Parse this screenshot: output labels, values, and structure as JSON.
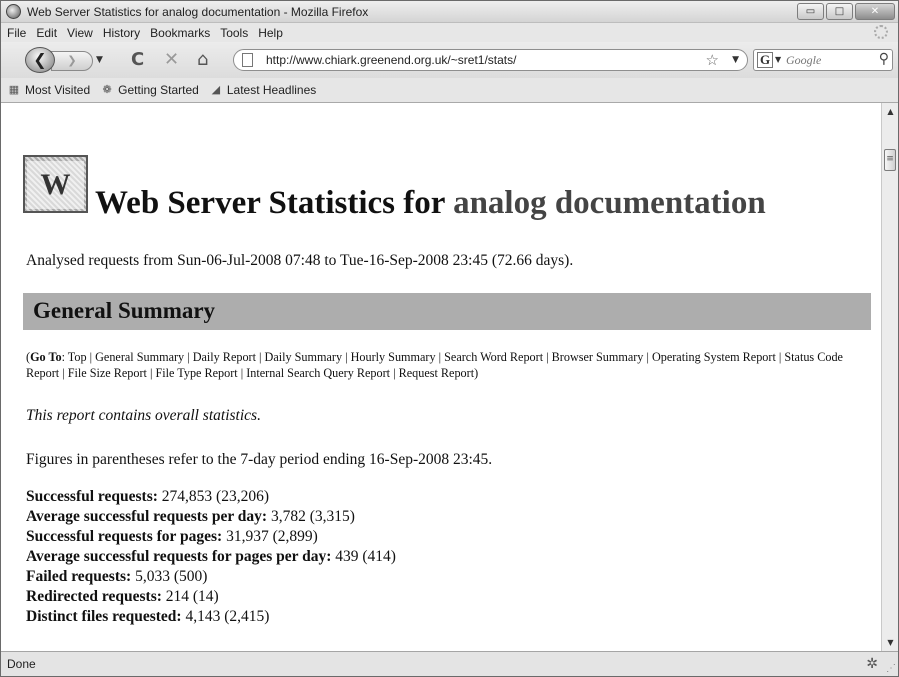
{
  "window": {
    "title": "Web Server Statistics for analog documentation - Mozilla Firefox",
    "controls": {
      "minimize": "▭",
      "maximize": "□",
      "close": "✕"
    }
  },
  "menu": [
    "File",
    "Edit",
    "View",
    "History",
    "Bookmarks",
    "Tools",
    "Help"
  ],
  "toolbar": {
    "back_glyph": "❮",
    "forward_glyph": "❯",
    "dropdown_glyph": "▼",
    "reload_glyph": "C",
    "stop_glyph": "✕",
    "home_glyph": "⌂",
    "url": "http://www.chiark.greenend.org.uk/~sret1/stats/",
    "bookmark_star_glyph": "☆",
    "search_engine_glyph": "G",
    "search_placeholder": "Google",
    "search_glyph": "⚲"
  },
  "bookmarks": [
    {
      "label": "Most Visited",
      "icon": "most-visited-icon",
      "glyph": "▦"
    },
    {
      "label": "Getting Started",
      "icon": "firefox-icon",
      "glyph": "❁"
    },
    {
      "label": "Latest Headlines",
      "icon": "rss-feed-icon",
      "glyph": "◢"
    }
  ],
  "page": {
    "logo_letter": "W",
    "heading_prefix": "Web Server Statistics for",
    "heading_subject": "analog documentation",
    "analysed": "Analysed requests from Sun-06-Jul-2008 07:48 to Tue-16-Sep-2008 23:45 (72.66 days).",
    "section_title": "General Summary",
    "goto": {
      "open": "(",
      "label": "Go To",
      "colon": ": ",
      "links": [
        "Top",
        "General Summary",
        "Daily Report",
        "Daily Summary",
        "Hourly Summary",
        "Search Word Report",
        "Browser Summary",
        "Operating System Report",
        "Status Code Report",
        "File Size Report",
        "File Type Report",
        "Internal Search Query Report",
        "Request Report"
      ],
      "separator": " | ",
      "close": ")"
    },
    "intro": "This report contains overall statistics.",
    "figures_note": "Figures in parentheses refer to the 7-day period ending 16-Sep-2008 23:45.",
    "stats": [
      {
        "label": "Successful requests:",
        "value": " 274,853 (23,206)"
      },
      {
        "label": "Average successful requests per day:",
        "value": " 3,782 (3,315)"
      },
      {
        "label": "Successful requests for pages:",
        "value": " 31,937 (2,899)"
      },
      {
        "label": "Average successful requests for pages per day:",
        "value": " 439 (414)"
      },
      {
        "label": "Failed requests:",
        "value": " 5,033 (500)"
      },
      {
        "label": "Redirected requests:",
        "value": " 214 (14)"
      },
      {
        "label": "Distinct files requested:",
        "value": " 4,143 (2,415)"
      }
    ]
  },
  "scrollbar": {
    "up_glyph": "▲",
    "down_glyph": "▼",
    "thumb_glyph": "≡"
  },
  "status": {
    "text": "Done",
    "icon_glyph": "✲",
    "grip_glyph": "⋰"
  }
}
